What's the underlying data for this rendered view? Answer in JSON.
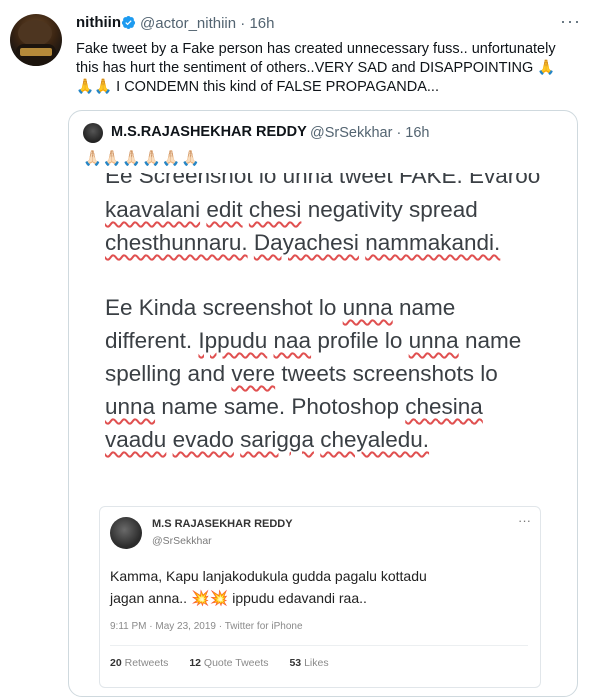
{
  "tweet": {
    "name": "nithiin",
    "handle": "@actor_nithiin",
    "time": "· 16h",
    "more": "···",
    "text": "Fake tweet by a Fake person has created unnecessary fuss.. unfortunately this has hurt the sentiment of others..VERY SAD and DISAPPOINTING 🙏\n🙏🙏 I CONDEMN this kind of FALSE PROPAGANDA..."
  },
  "quote": {
    "name": "M.S.RAJASHEKHAR REDDY",
    "handle": "@SrSekkhar · 16h",
    "emojis": "🙏🏻🙏🏻🙏🏻🙏🏻🙏🏻🙏🏻",
    "screenshot_lines": {
      "l0": "Ee Screenshot lo unna tweet FAKE. Evaroo",
      "l1a": "kaavalani",
      "l1b": "edit",
      "l1c": "chesi",
      "l1d": "negativity spread",
      "l2a": "chesthunnaru.",
      "l2b": "Dayachesi",
      "l2c": "nammakandi.",
      "l3a": "Ee Kinda screenshot lo",
      "l3b": "unna",
      "l3c": "name",
      "l4a": "different.",
      "l4b": "Ippudu",
      "l4c": "naa",
      "l4d": "profile lo",
      "l4e": "unna",
      "l4f": "name",
      "l5a": "spelling and",
      "l5b": "vere",
      "l5c": "tweets screenshots lo",
      "l6a": "unna",
      "l6b": "name same. Photoshop",
      "l6c": "chesina",
      "l7a": "vaadu",
      "l7b": "evado",
      "l7c": "sarigga",
      "l7d": "cheyaledu."
    },
    "embedded": {
      "name": "M.S RAJASEKHAR REDDY",
      "handle": "@SrSekkhar",
      "more": "···",
      "line1": "Kamma, Kapu lanjakodukula gudda pagalu kottadu",
      "line2a": "jagan anna..",
      "line2b": "ippudu edavandi raa..",
      "boom": "💥💥",
      "meta": "9:11 PM · May 23, 2019 · Twitter for iPhone",
      "retweets_count": "20",
      "retweets_label": "Retweets",
      "quotes_count": "12",
      "quotes_label": "Quote Tweets",
      "likes_count": "53",
      "likes_label": "Likes"
    }
  },
  "colors": {
    "verified": "#1d9bf0",
    "squiggle": "#e05050"
  }
}
